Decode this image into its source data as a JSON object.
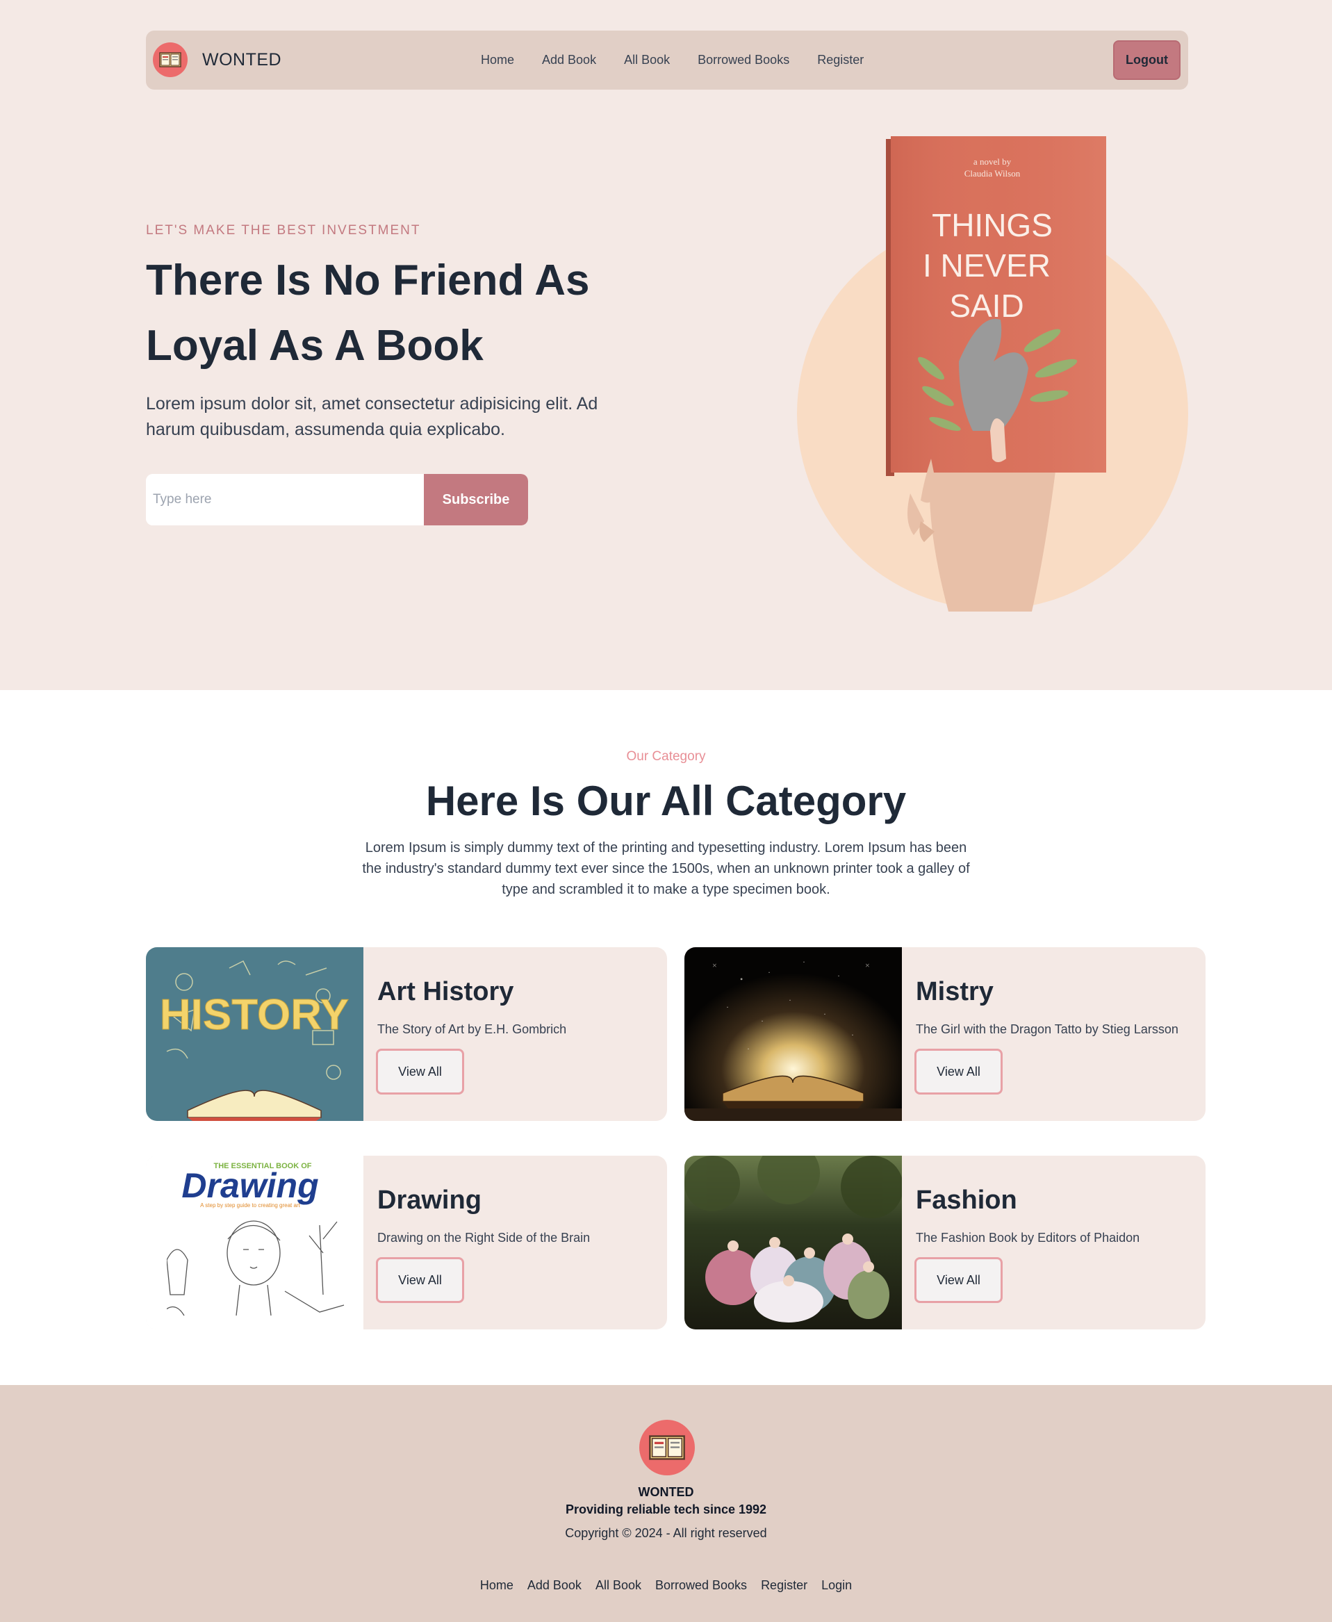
{
  "nav": {
    "brand": "WONTED",
    "links": [
      "Home",
      "Add Book",
      "All Book",
      "Borrowed Books",
      "Register"
    ],
    "logout_label": "Logout"
  },
  "hero": {
    "tagline": "LET'S MAKE THE BEST INVESTMENT",
    "title": "There Is No Friend As Loyal As A Book",
    "text": "Lorem ipsum dolor sit, amet consectetur adipisicing elit. Ad harum quibusdam, assumenda quia explicabo.",
    "input_placeholder": "Type here",
    "subscribe_label": "Subscribe",
    "book": {
      "author_line1": "a novel by",
      "author_line2": "Claudia Wilson",
      "title_line1": "THINGS",
      "title_line2": "I NEVER",
      "title_line3": "SAID"
    }
  },
  "category": {
    "eyebrow": "Our Category",
    "title": "Here Is Our All Category",
    "text": "Lorem Ipsum is simply dummy text of the printing and typesetting industry. Lorem Ipsum has been the industry's standard dummy text ever since the 1500s, when an unknown printer took a galley of type and scrambled it to make a type specimen book.",
    "cards": [
      {
        "title": "Art History",
        "subtitle": "The Story of Art by E.H. Gombrich",
        "button": "View All",
        "image_word": "HISTORY"
      },
      {
        "title": "Mistry",
        "subtitle": "The Girl with the Dragon Tatto by Stieg Larsson",
        "button": "View All"
      },
      {
        "title": "Drawing",
        "subtitle": "Drawing on the Right Side of the Brain",
        "button": "View All",
        "image_word": "Drawing",
        "image_top": "THE ESSENTIAL BOOK OF",
        "image_tagline": "A step by step guide to creating great art"
      },
      {
        "title": "Fashion",
        "subtitle": "The Fashion Book by Editors of Phaidon",
        "button": "View All"
      }
    ]
  },
  "footer": {
    "brand": "WONTED",
    "tagline": "Providing reliable tech since 1992",
    "copyright": "Copyright © 2024 - All right reserved",
    "links": [
      "Home",
      "Add Book",
      "All Book",
      "Borrowed Books",
      "Register",
      "Login"
    ]
  },
  "colors": {
    "hero_bg": "#f4e9e5",
    "nav_bg": "#e1cfc6",
    "accent": "#c37980",
    "logo_red": "#ec6b6b",
    "circle_peach": "#f9dcc4",
    "book_cover": "#d9715c",
    "card_bg": "#f4e9e5",
    "button_border": "#e8a1a6"
  },
  "icons": {
    "logo": "open-book-icon"
  }
}
